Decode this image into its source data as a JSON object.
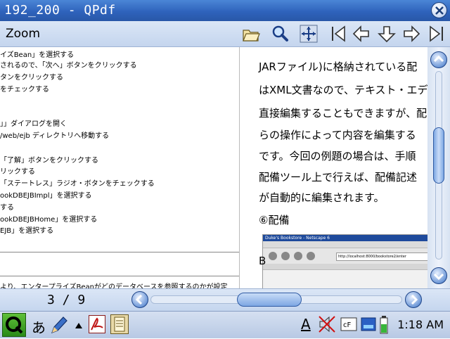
{
  "window": {
    "title": "192_200 - QPdf"
  },
  "menu": {
    "zoom_label": "Zoom"
  },
  "toolbar": {
    "buttons": [
      "open-folder",
      "search",
      "fit-page",
      "first-page",
      "previous-page",
      "next-page-down",
      "next-page",
      "last-page"
    ]
  },
  "left_page": {
    "lines": [
      "イズBean」を選択する",
      "されるので、「次へ」ボタンをクリックする",
      "タンをクリックする",
      "をチェックする",
      "」」ダイアログを開く",
      "/web/ejb ディレクトリへ移動する",
      "「了解」ボタンをクリックする",
      "リックする",
      "「ステートレス」ラジオ・ボタンをチェックする",
      "ookDBEJBImpl」を選択する",
      "する",
      "ookDBEJBHome」を選択する",
      "EJB」を選択する",
      "より、エンタープライズBeanがどのデータベースを参照するのかが設定"
    ]
  },
  "right_page": {
    "lines": [
      "JARファイル)に格納されている配",
      "はXML文書なので、テキスト・エデ",
      "直接編集することもできますが、配",
      "らの操作によって内容を編集する",
      "です。今回の例題の場合は、手順",
      "配備ツール上で行えば、配備記述",
      "が自動的に編集されます。",
      "⑥配備"
    ],
    "fragment": "B",
    "screenshot_title": "Duke's Bookstore - Netscape 6",
    "screenshot_url": "http://localhost:8000/bookstore2/enter"
  },
  "scroll": {
    "vertical_position": 0.33,
    "horizontal_position": 0.47
  },
  "status": {
    "page_indicator": "3 / 9"
  },
  "taskbar": {
    "input_method": "あ",
    "text_indicator": "A",
    "clock": "1:18 AM"
  },
  "colors": {
    "titlebar": "#2f63bc",
    "panel": "#c4d5ee",
    "accent": "#2b5aa6"
  }
}
